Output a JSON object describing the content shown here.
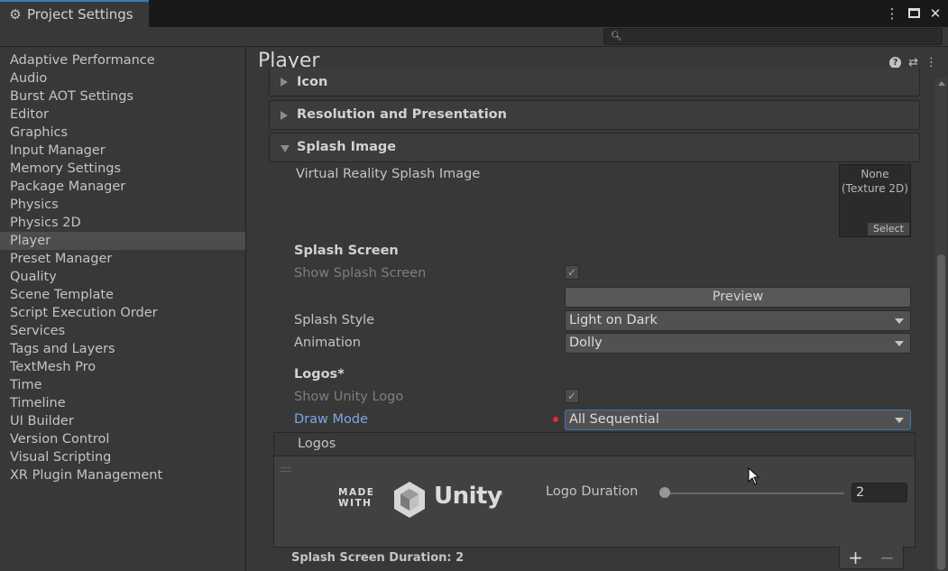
{
  "window": {
    "tab_title": "Project Settings",
    "icons": [
      "gear-icon",
      "more-icon",
      "maximize-icon",
      "close-icon"
    ]
  },
  "search": {
    "placeholder": "",
    "icon": "search-icon"
  },
  "sidebar": {
    "items": [
      {
        "label": "Adaptive Performance"
      },
      {
        "label": "Audio"
      },
      {
        "label": "Burst AOT Settings"
      },
      {
        "label": "Editor"
      },
      {
        "label": "Graphics"
      },
      {
        "label": "Input Manager"
      },
      {
        "label": "Memory Settings"
      },
      {
        "label": "Package Manager"
      },
      {
        "label": "Physics"
      },
      {
        "label": "Physics 2D"
      },
      {
        "label": "Player",
        "selected": true
      },
      {
        "label": "Preset Manager"
      },
      {
        "label": "Quality"
      },
      {
        "label": "Scene Template"
      },
      {
        "label": "Script Execution Order"
      },
      {
        "label": "Services"
      },
      {
        "label": "Tags and Layers"
      },
      {
        "label": "TextMesh Pro"
      },
      {
        "label": "Time"
      },
      {
        "label": "Timeline"
      },
      {
        "label": "UI Builder"
      },
      {
        "label": "Version Control"
      },
      {
        "label": "Visual Scripting"
      },
      {
        "label": "XR Plugin Management"
      }
    ]
  },
  "main": {
    "title": "Player",
    "header_icons": [
      "help-icon",
      "preset-icon",
      "more-icon"
    ],
    "sections": {
      "icon": "Icon",
      "resolution": "Resolution and Presentation",
      "splash": "Splash Image"
    },
    "vr_splash_label": "Virtual Reality Splash Image",
    "texture_field": {
      "none": "None",
      "type": "(Texture 2D)",
      "select": "Select"
    },
    "splash_screen": {
      "heading": "Splash Screen",
      "show_label": "Show Splash Screen",
      "show_checked": true,
      "preview_button": "Preview",
      "style_label": "Splash Style",
      "style_value": "Light on Dark",
      "animation_label": "Animation",
      "animation_value": "Dolly"
    },
    "logos": {
      "heading": "Logos*",
      "show_unity_label": "Show Unity Logo",
      "show_unity_checked": true,
      "draw_mode_label": "Draw Mode",
      "draw_mode_value": "All Sequential",
      "list_title": "Logos",
      "made_with_line1": "MADE",
      "made_with_line2": "WITH",
      "unity_word": "Unity",
      "unity_tm": "®",
      "duration_label": "Logo Duration",
      "duration_value": "2",
      "duration_slider_fraction": 0.0
    },
    "footer": {
      "duration_text": "Splash Screen Duration: 2",
      "add": "+",
      "remove": "−"
    }
  },
  "colors": {
    "accent": "#3a79bb",
    "override_dot": "#e52b2b",
    "draw_mode_label": "#7ba7e6"
  }
}
